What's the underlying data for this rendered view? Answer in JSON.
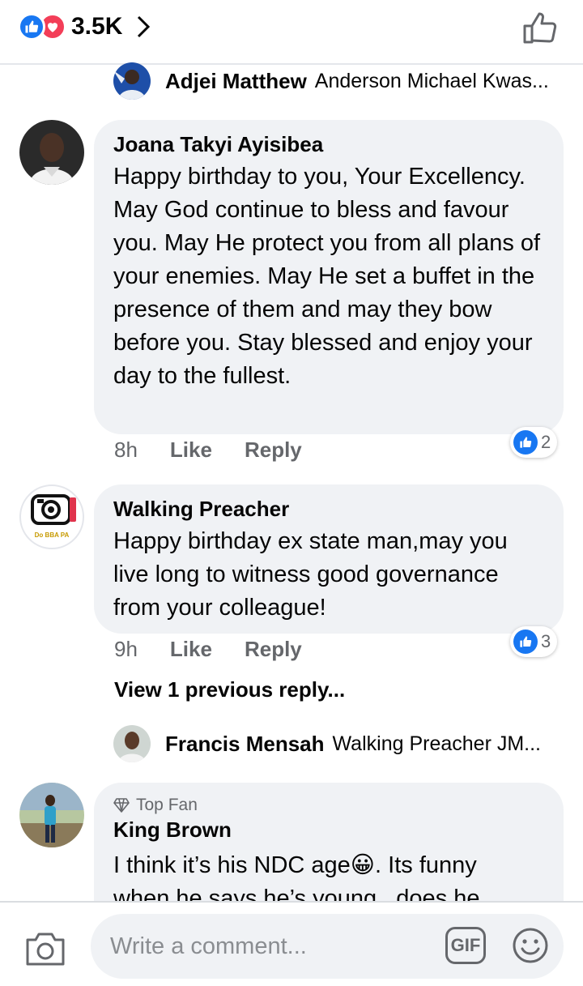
{
  "header": {
    "reaction_count": "3.5K",
    "colors": {
      "like_blue": "#1877f2",
      "love_red": "#f33e58"
    }
  },
  "comments": [
    {
      "type": "reply_preview",
      "name": "Adjei Matthew",
      "text": "Anderson Michael Kwas..."
    },
    {
      "type": "comment",
      "name": "Joana Takyi Ayisibea",
      "text": "Happy birthday to you, Your Excellency. May God continue to bless and favour you. May He protect you from all plans of your enemies. May He set a buffet in the presence of them and may they bow before you. Stay blessed and enjoy your day to the fullest.",
      "time": "8h",
      "like_label": "Like",
      "reply_label": "Reply",
      "reaction_count": "2"
    },
    {
      "type": "comment",
      "name": "Walking Preacher",
      "text": "Happy birthday ex state man,may you live long to witness good governance from your colleague!",
      "time": "9h",
      "like_label": "Like",
      "reply_label": "Reply",
      "reaction_count": "3",
      "avatar_caption": "Do BBA PA"
    },
    {
      "type": "view_previous",
      "label": "View 1 previous reply..."
    },
    {
      "type": "reply_preview",
      "name": "Francis Mensah",
      "text": "Walking Preacher JM..."
    },
    {
      "type": "comment",
      "badge": "Top Fan",
      "name": "King Brown",
      "text_line1": "I think it’s his NDC age😀. Its funny",
      "text_line2": "when he says he’s young...does he"
    }
  ],
  "composer": {
    "placeholder": "Write a comment...",
    "gif_label": "GIF"
  }
}
